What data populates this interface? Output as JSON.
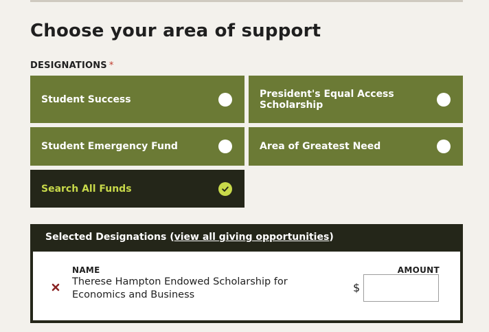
{
  "page_title": "Choose your area of support",
  "designations": {
    "label": "DESIGNATIONS",
    "required_mark": "*",
    "options": [
      {
        "label": "Student Success",
        "selected": false
      },
      {
        "label": "President's Equal Access Scholarship",
        "selected": false
      },
      {
        "label": "Student Emergency Fund",
        "selected": false
      },
      {
        "label": "Area of Greatest Need",
        "selected": false
      },
      {
        "label": "Search All Funds",
        "selected": true
      }
    ]
  },
  "selected_designations": {
    "title_prefix": "Selected Designations (",
    "link_text": "view all giving opportunities",
    "title_suffix": ")",
    "name_header": "NAME",
    "amount_header": "AMOUNT",
    "currency_symbol": "$",
    "items": [
      {
        "name": "Therese Hampton Endowed Scholarship for Economics and Business",
        "amount": ""
      }
    ]
  },
  "colors": {
    "card_green": "#6b7a35",
    "card_selected": "#242619",
    "accent_lime": "#c8d94a",
    "remove_red": "#8a2424"
  },
  "icons": {
    "radio": "radio-circle-icon",
    "check": "check-icon",
    "remove": "remove-x-icon"
  }
}
